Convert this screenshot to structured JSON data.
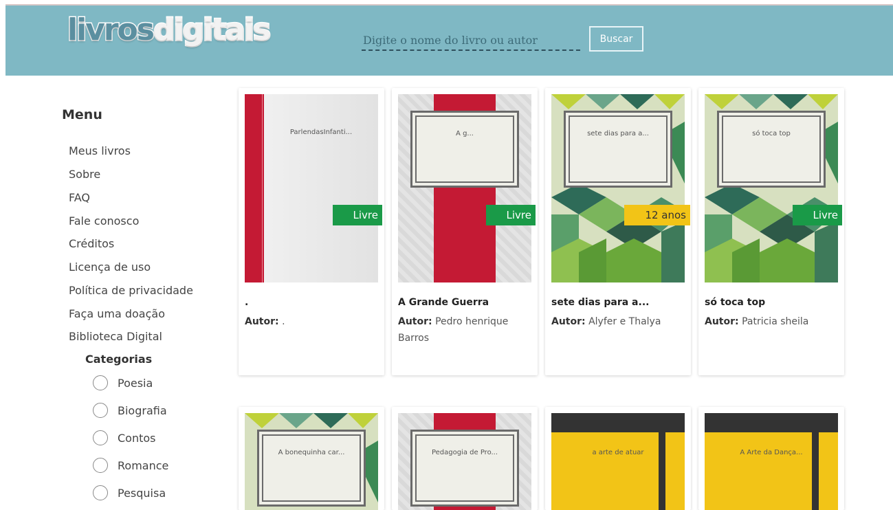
{
  "header": {
    "logo_part1": "livros",
    "logo_part2": "digitais",
    "search_placeholder": "Digite o nome do livro ou autor",
    "search_button": "Buscar"
  },
  "sidebar": {
    "menu_title": "Menu",
    "items": [
      "Meus livros",
      "Sobre",
      "FAQ",
      "Fale conosco",
      "Créditos",
      "Licença de uso",
      "Política de privacidade",
      "Faça uma doação",
      "Biblioteca Digital"
    ],
    "categories_title": "Categorias",
    "categories": [
      "Poesia",
      "Biografia",
      "Contos",
      "Romance",
      "Pesquisa"
    ]
  },
  "author_label": "Autor:",
  "books": [
    {
      "cover_title": "ParlendasInfanti...",
      "title": ".",
      "author": ".",
      "badge": "Livre",
      "cover": "plain"
    },
    {
      "cover_title": "A g...",
      "title": "A Grande Guerra",
      "author": "Pedro henrique Barros",
      "badge": "Livre",
      "cover": "grey"
    },
    {
      "cover_title": "sete dias para a...",
      "title": "sete dias para a...",
      "author": "Alyfer e Thalya",
      "badge": "12 anos",
      "cover": "geo"
    },
    {
      "cover_title": "só toca top",
      "title": "só toca top",
      "author": "Patricia sheila",
      "badge": "Livre",
      "cover": "geo"
    },
    {
      "cover_title": "A bonequinha car...",
      "cover": "geo"
    },
    {
      "cover_title": "Pedagogia de Pro...",
      "cover": "grey"
    },
    {
      "cover_title": "a arte de atuar",
      "cover": "yellow"
    },
    {
      "cover_title": "A Arte da Dança...",
      "cover": "yellow"
    }
  ],
  "colors": {
    "header": "#7fb8c4",
    "badge_green": "#1a9a48",
    "badge_yellow": "#f2c417",
    "spine_red": "#c41a34"
  }
}
